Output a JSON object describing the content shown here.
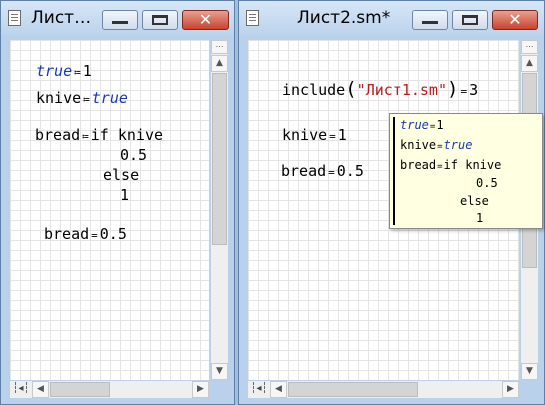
{
  "window1": {
    "title": "Лист…",
    "lines": {
      "true_name": "true",
      "true_assign": "≔",
      "true_value": "1",
      "knive_name": "knive",
      "knive_assign": "≔",
      "knive_value": "true",
      "bread_name": "bread",
      "bread_assign": "≔",
      "bread_if": "if knive",
      "bread_then": "0.5",
      "bread_else": "else",
      "bread_else_value": "1",
      "eval_name": "bread",
      "eval_eq": "=",
      "eval_value": "0.5"
    }
  },
  "window2": {
    "title": "Лист2.sm*",
    "lines": {
      "include_fn": "include",
      "include_open": "(",
      "include_arg": "\"Лист1.sm\"",
      "include_close": ")",
      "include_eq": "=",
      "include_value": "3",
      "knive_name": "knive",
      "knive_eq": "=",
      "knive_value": "1",
      "bread_name": "bread",
      "bread_eq": "=",
      "bread_value": "0.5"
    },
    "tooltip": {
      "l1_name": "true",
      "l1_eq": "=",
      "l1_value": "1",
      "l2_name": "knive",
      "l2_eq": "=",
      "l2_value": "true",
      "l3_name": "bread",
      "l3_eq": "=",
      "l3_if": "if knive",
      "l4": "0.5",
      "l5": "else",
      "l6": "1"
    }
  },
  "controls": {
    "minimize": "minimize",
    "maximize": "maximize",
    "close": "✕"
  }
}
